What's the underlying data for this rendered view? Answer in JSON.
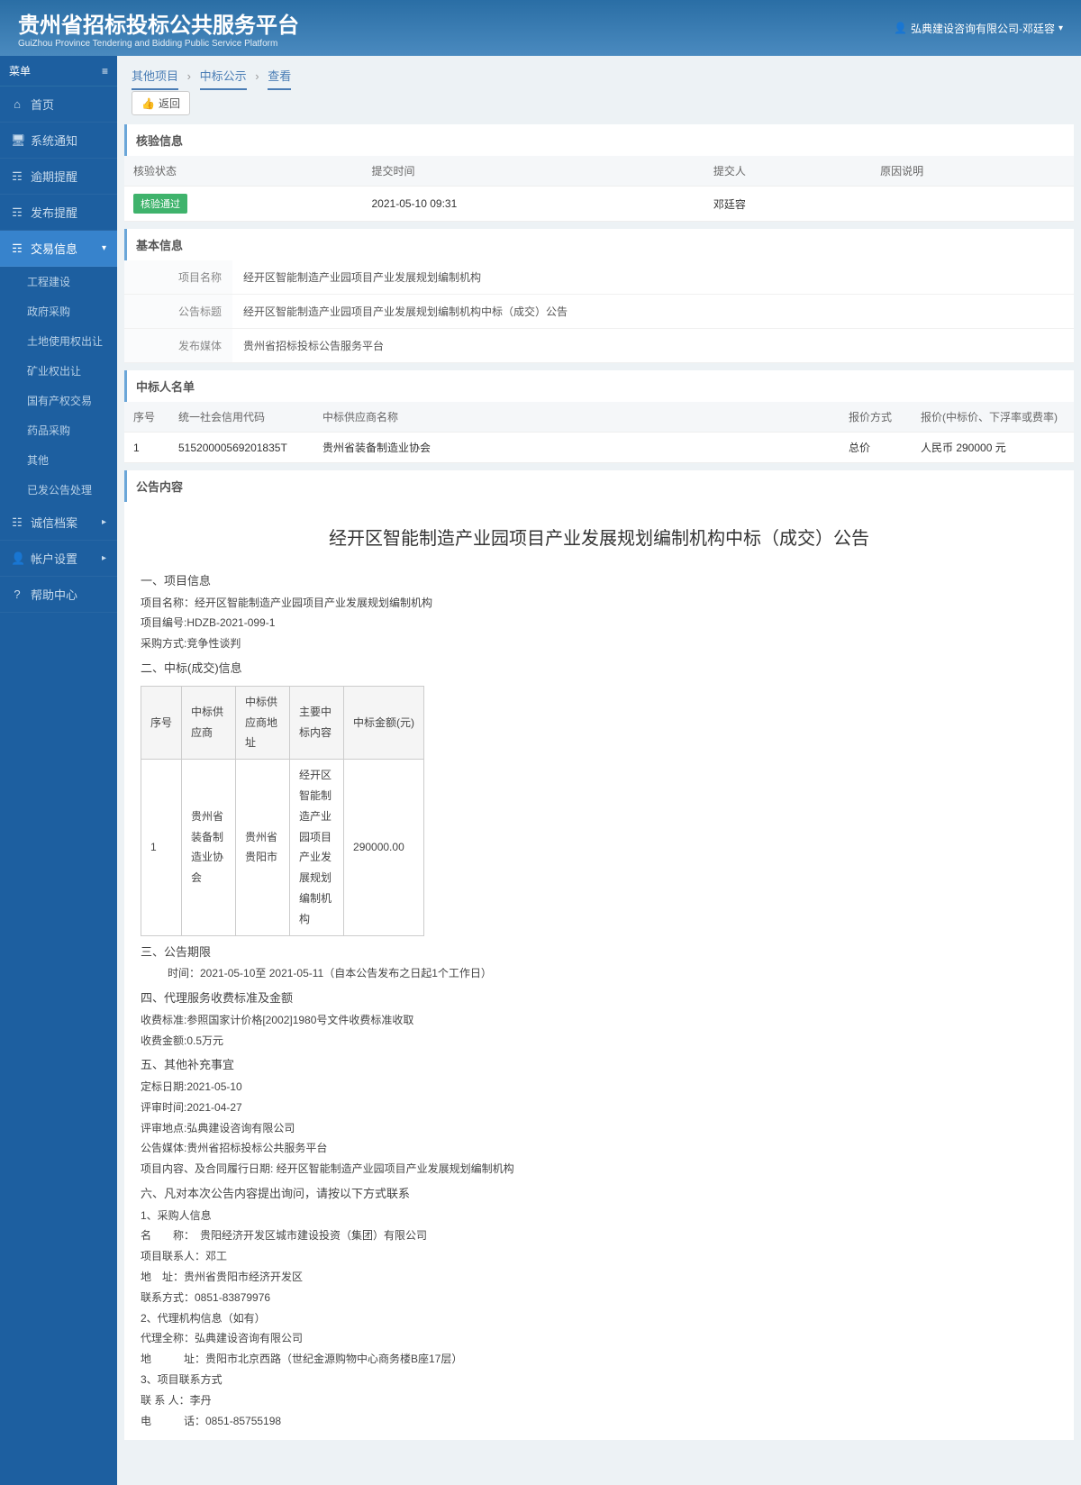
{
  "header": {
    "title": "贵州省招标投标公共服务平台",
    "subtitle": "GuiZhou Province Tendering and Bidding Public Service Platform",
    "user": "弘典建设咨询有限公司-邓廷容"
  },
  "sidebar": {
    "menu_label": "菜单",
    "items": [
      {
        "icon": "⌂",
        "label": "首页"
      },
      {
        "icon": "🖥",
        "label": "系统通知"
      },
      {
        "icon": "☶",
        "label": "逾期提醒"
      },
      {
        "icon": "☶",
        "label": "发布提醒"
      },
      {
        "icon": "☶",
        "label": "交易信息",
        "active": true,
        "arrow": "▾"
      },
      {
        "icon": "☷",
        "label": "诚信档案",
        "arrow": "▸"
      },
      {
        "icon": "👤",
        "label": "帐户设置",
        "arrow": "▸"
      },
      {
        "icon": "?",
        "label": "帮助中心"
      }
    ],
    "submenu": [
      "工程建设",
      "政府采购",
      "土地使用权出让",
      "矿业权出让",
      "国有产权交易",
      "药品采购",
      "其他",
      "已发公告处理"
    ]
  },
  "breadcrumb": [
    "其他项目",
    "中标公示",
    "查看"
  ],
  "back_label": "返回",
  "panels": {
    "verify_title": "核验信息",
    "basic_title": "基本信息",
    "winners_title": "中标人名单",
    "notice_title": "公告内容"
  },
  "verify": {
    "headers": [
      "核验状态",
      "提交时间",
      "提交人",
      "原因说明"
    ],
    "row": {
      "status": "核验通过",
      "time": "2021-05-10 09:31",
      "submitter": "邓廷容",
      "reason": ""
    }
  },
  "basic": {
    "rows": [
      {
        "label": "项目名称",
        "value": "经开区智能制造产业园项目产业发展规划编制机构"
      },
      {
        "label": "公告标题",
        "value": "经开区智能制造产业园项目产业发展规划编制机构中标（成交）公告"
      },
      {
        "label": "发布媒体",
        "value": "贵州省招标投标公告服务平台"
      }
    ]
  },
  "winners": {
    "headers": [
      "序号",
      "统一社会信用代码",
      "中标供应商名称",
      "报价方式",
      "报价(中标价、下浮率或费率)"
    ],
    "rows": [
      {
        "seq": "1",
        "code": "51520000569201835T",
        "name": "贵州省装备制造业协会",
        "method": "总价",
        "price": "人民币 290000 元"
      }
    ]
  },
  "notice": {
    "main_title": "经开区智能制造产业园项目产业发展规划编制机构中标（成交）公告",
    "s1_title": "一、项目信息",
    "proj_name": "项目名称：经开区智能制造产业园项目产业发展规划编制机构",
    "proj_no": "项目编号:HDZB-2021-099-1",
    "method": "采购方式:竞争性谈判",
    "s2_title": "二、中标(成交)信息",
    "bid_table": {
      "headers": [
        "序号",
        "中标供应商",
        "中标供应商地址",
        "主要中标内容",
        "中标金额(元)"
      ],
      "row": {
        "seq": "1",
        "supplier": "贵州省装备制造业协会",
        "addr": "贵州省贵阳市",
        "content": "经开区智能制造产业园项目产业发展规划编制机构",
        "amount": "290000.00"
      }
    },
    "s3_title": "三、公告期限",
    "s3_time": "时间：2021-05-10至 2021-05-11（自本公告发布之日起1个工作日）",
    "s4_title": "四、代理服务收费标准及金额",
    "fee_std": "收费标准:参照国家计价格[2002]1980号文件收费标准收取",
    "fee_amt": "收费金额:0.5万元",
    "s5_title": "五、其他补充事宜",
    "decide_date": "定标日期:2021-05-10",
    "review_time": "评审时间:2021-04-27",
    "review_place": "评审地点:弘典建设咨询有限公司",
    "media": "公告媒体:贵州省招标投标公共服务平台",
    "proj_content": "项目内容、及合同履行日期: 经开区智能制造产业园项目产业发展规划编制机构",
    "s6_title": "六、凡对本次公告内容提出询问，请按以下方式联系",
    "buyer_title": "1、采购人信息",
    "buyer_name": "名　　称：　贵阳经济开发区城市建设投资（集团）有限公司",
    "buyer_contact": "项目联系人：邓工",
    "buyer_addr": "地　址：贵州省贵阳市经济开发区",
    "buyer_tel": "联系方式：0851-83879976",
    "agent_title": "2、代理机构信息（如有）",
    "agent_name": "代理全称：弘典建设咨询有限公司",
    "agent_addr": "地　　　址：贵阳市北京西路（世纪金源购物中心商务楼B座17层）",
    "contact_title": "3、项目联系方式",
    "contact_person": "联 系  人：李丹",
    "contact_tel": "电　　　话：0851-85755198"
  }
}
